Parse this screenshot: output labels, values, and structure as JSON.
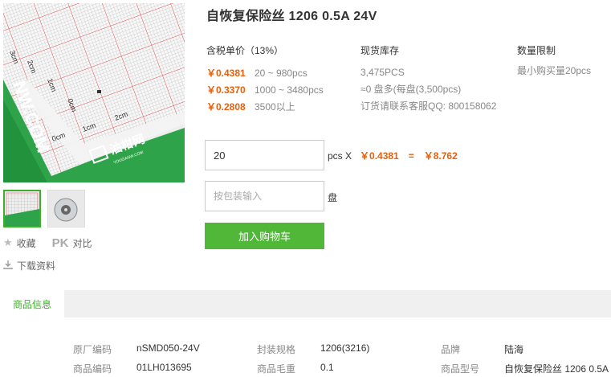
{
  "product": {
    "title": "自恢复保险丝 1206 0.5A 24V",
    "image_brand": {
      "name": "油柑网",
      "url_text": "YOUGANW.COM",
      "side_text": "NW.COM"
    },
    "ruler_labels": {
      "h": [
        "0cm",
        "1cm",
        "2cm"
      ],
      "v": [
        "1cm",
        "2cm",
        "3cm",
        "0cm"
      ]
    }
  },
  "actions": {
    "favorite": "收藏",
    "pk": "PK",
    "compare": "对比",
    "download": "下载资料"
  },
  "pricing": {
    "header": "含税单价（13%）",
    "rows": [
      {
        "price": "￥0.4381",
        "qty": "20 ~ 980pcs"
      },
      {
        "price": "￥0.3370",
        "qty": "1000 ~ 3480pcs"
      },
      {
        "price": "￥0.2808",
        "qty": "3500以上"
      }
    ]
  },
  "stock": {
    "header": "现货库存",
    "lines": [
      "3,475PCS",
      "≈0 盘多(每盘(3,500pcs)",
      "订货请联系客服QQ: 800158062"
    ]
  },
  "limit": {
    "header": "数量限制",
    "text": "最小购买量20pcs"
  },
  "order": {
    "quantity": "20",
    "unit": "pcs X",
    "unit_price": "￥0.4381",
    "equals": "=",
    "total": "￥8.762",
    "pack_placeholder": "按包装输入",
    "pack_unit": "盘",
    "cart_button": "加入购物车"
  },
  "info_tab": "商品信息",
  "info": [
    [
      {
        "label": "原厂编码",
        "value": "nSMD050-24V"
      },
      {
        "label": "封装规格",
        "value": "1206(3216)"
      },
      {
        "label": "品牌",
        "value": "陆海"
      }
    ],
    [
      {
        "label": "商品编码",
        "value": "01LH013695"
      },
      {
        "label": "商品毛重",
        "value": "0.1"
      },
      {
        "label": "商品型号",
        "value": "自恢复保险丝 1206 0.5A"
      }
    ]
  ],
  "colors": {
    "accent_green": "#50b739",
    "price_orange": "#e8600b"
  }
}
